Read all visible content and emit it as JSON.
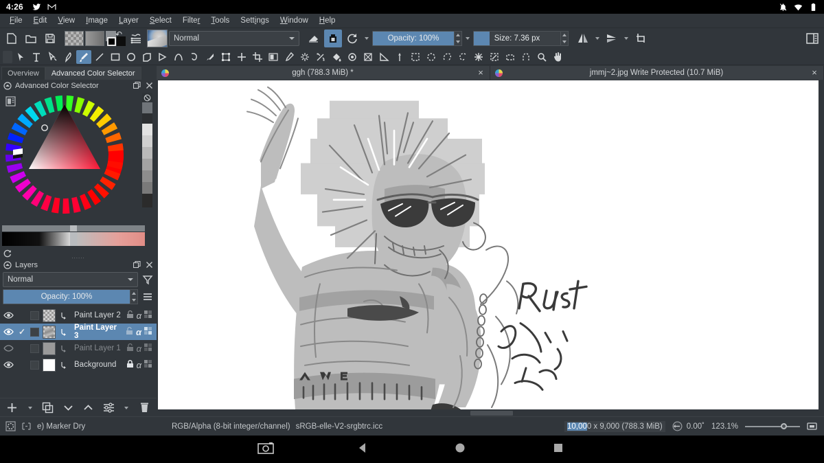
{
  "android": {
    "clock": "4:26",
    "left_icons": [
      "twitter-bird-icon",
      "gmail-icon"
    ],
    "right_icons": [
      "notifications-muted-icon",
      "wifi-icon",
      "battery-icon"
    ],
    "nav": {
      "screenshot": "screenshot-icon",
      "back": "back-icon",
      "home": "home-icon",
      "recents": "recents-icon"
    }
  },
  "menubar": {
    "items": [
      {
        "label": "File",
        "mnemonic": "F"
      },
      {
        "label": "Edit",
        "mnemonic": "E"
      },
      {
        "label": "View",
        "mnemonic": "V"
      },
      {
        "label": "Image",
        "mnemonic": "I"
      },
      {
        "label": "Layer",
        "mnemonic": "L"
      },
      {
        "label": "Select",
        "mnemonic": "S"
      },
      {
        "label": "Filter",
        "mnemonic": "r"
      },
      {
        "label": "Tools",
        "mnemonic": "T"
      },
      {
        "label": "Settings",
        "mnemonic": "i"
      },
      {
        "label": "Window",
        "mnemonic": "W"
      },
      {
        "label": "Help",
        "mnemonic": "H"
      }
    ]
  },
  "toolbar": {
    "new_label": "new-document-icon",
    "open_label": "open-document-icon",
    "save_label": "save-icon",
    "pattern_label": "pattern-swatch",
    "gradient_label": "gradient-swatch",
    "fgbg_label": "foreground-background-colors",
    "presets_label": "brush-presets-icon",
    "preset_thumb_label": "brush-preset-thumbnail",
    "blend_mode": "Normal",
    "eraser_label": "eraser-icon",
    "preserve_alpha_label": "preserve-alpha-icon",
    "reload_label": "reload-preset-icon",
    "opacity_label": "Opacity: 100%",
    "opacity_value": 100,
    "size_label": "Size: 7.36 px",
    "size_value": 7.36,
    "size_fill_percent": 18,
    "mirror_h_label": "mirror-horizontal-icon",
    "mirror_v_label": "mirror-vertical-icon",
    "wrap_label": "wrap-around-icon",
    "workspace_label": "workspace-chooser-icon"
  },
  "tools": {
    "items": [
      "select-shapes-tool",
      "text-tool",
      "edit-shapes-tool",
      "calligraphy-tool",
      "freehand-brush-tool",
      "line-tool",
      "rectangle-tool",
      "ellipse-tool",
      "polygon-tool",
      "polyline-tool",
      "bezier-curve-tool",
      "freehand-path-tool",
      "dynamic-brush-tool",
      "multibrush-tool",
      "transform-tool",
      "move-tool",
      "crop-tool",
      "gradient-tool",
      "color-sampler-tool",
      "colorize-mask-tool",
      "smart-patch-tool",
      "fill-tool",
      "enclose-and-fill-tool",
      "assistant-tool",
      "measure-tool",
      "reference-images-tool",
      "rectangular-selection-tool",
      "elliptical-selection-tool",
      "polygonal-selection-tool",
      "freehand-selection-tool",
      "contiguous-selection-tool",
      "similar-color-selection-tool",
      "bezier-selection-tool",
      "magnetic-selection-tool",
      "zoom-tool",
      "pan-tool"
    ],
    "selected_index": 4
  },
  "left_dock": {
    "tabs": [
      {
        "label": "Overview",
        "active": false
      },
      {
        "label": "Advanced Color Selector",
        "active": true
      }
    ],
    "color_selector": {
      "title": "Advanced Color Selector",
      "settings_icon": "selector-settings-icon",
      "float_icon": "float-docker-icon",
      "close_icon": "close-docker-icon",
      "clear_icon": "no-color-icon",
      "refresh_icon": "refresh-icon",
      "shade_column": [
        "#6f7479",
        "#2c2f32",
        "#e2e2e2",
        "#d0d0d0",
        "#b9b9b9",
        "#a3a3a3",
        "#8d8d8d",
        "#7a7a7a",
        "#2b2b2b"
      ]
    },
    "layers": {
      "title": "Layers",
      "float_icon": "float-docker-icon",
      "close_icon": "close-docker-icon",
      "blend_mode": "Normal",
      "filter_icon": "filter-layers-icon",
      "menu_icon": "layer-menu-icon",
      "opacity_label": "Opacity:  100%",
      "opacity_value": 100,
      "rows": [
        {
          "name": "Paint Layer 2",
          "visible": true,
          "checked": false,
          "selected": false,
          "locked": false,
          "thumb": "checker"
        },
        {
          "name": "Paint Layer 3",
          "visible": true,
          "checked": true,
          "selected": true,
          "locked": false,
          "thumb": "art"
        },
        {
          "name": "Paint Layer 1",
          "visible": false,
          "checked": false,
          "selected": false,
          "locked": false,
          "thumb": "grey"
        },
        {
          "name": "Background",
          "visible": true,
          "checked": false,
          "selected": false,
          "locked": true,
          "thumb": "white"
        }
      ],
      "buttons": [
        "add-layer-button",
        "duplicate-layer-button",
        "move-layer-down-button",
        "move-layer-up-button",
        "layer-properties-button",
        "delete-layer-button"
      ]
    }
  },
  "documents": {
    "tabs": [
      {
        "label": "ggh (788.3 MiB) *",
        "active": true,
        "icon": "krita-document-icon",
        "close": "×"
      },
      {
        "label": "jmmj~2.jpg Write Protected (10.7 MiB)",
        "active": false,
        "icon": "krita-document-icon",
        "close": "×"
      }
    ]
  },
  "canvas": {
    "artwork_description": "grayscale character sketch with raised arm, spiky hair and sunglasses",
    "handwritten_text": "Rust"
  },
  "statusbar": {
    "selection_icon": "selection-mask-icon",
    "pixel_grid_icon": "pixel-grid-icon",
    "brush_preset": "e) Marker Dry",
    "color_space": "RGB/Alpha (8-bit integer/channel)",
    "color_profile": "sRGB-elle-V2-srgbtrc.icc",
    "dimensions_selected": "10,00",
    "dimensions_rest": "0 x 9,000 (788.3 MiB)",
    "rotation_icon": "rotation-icon",
    "rotation": "0.00˚",
    "zoom": "123.1%",
    "fit_icon": "fit-to-view-icon"
  },
  "colors": {
    "accent": "#5c87b1",
    "panel": "#31363b",
    "panel_light": "#3b4045",
    "text": "#d2d5d8"
  }
}
